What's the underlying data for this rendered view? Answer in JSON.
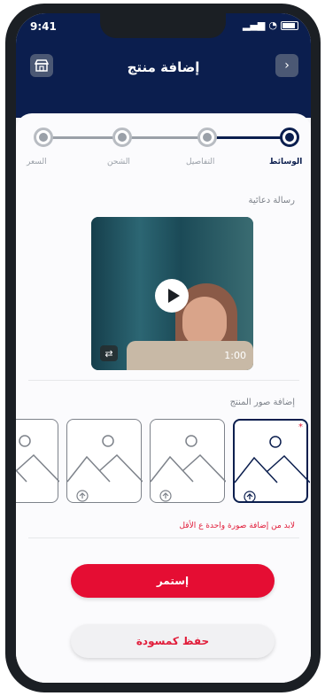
{
  "status_bar": {
    "time": "9:41"
  },
  "header": {
    "title": "إضافة منتج",
    "store_icon": "store-icon",
    "back_icon": "chevron-right-icon"
  },
  "stepper": {
    "steps": [
      {
        "label": "الوسائط",
        "active": true
      },
      {
        "label": "التفاصيل",
        "active": false
      },
      {
        "label": "الشحن",
        "active": false
      },
      {
        "label": "السعر",
        "active": false
      }
    ]
  },
  "promo": {
    "label": "رسالة دعائية",
    "duration": "1:00"
  },
  "images": {
    "label": "إضافة صور المنتج",
    "required_mark": "*",
    "error": "لابد من إضافة صورة واحدة ع الأقل"
  },
  "actions": {
    "continue": "إستمر",
    "save_draft": "حفظ كمسودة"
  },
  "colors": {
    "navy": "#0b1e4e",
    "accent_red": "#e50d33"
  }
}
